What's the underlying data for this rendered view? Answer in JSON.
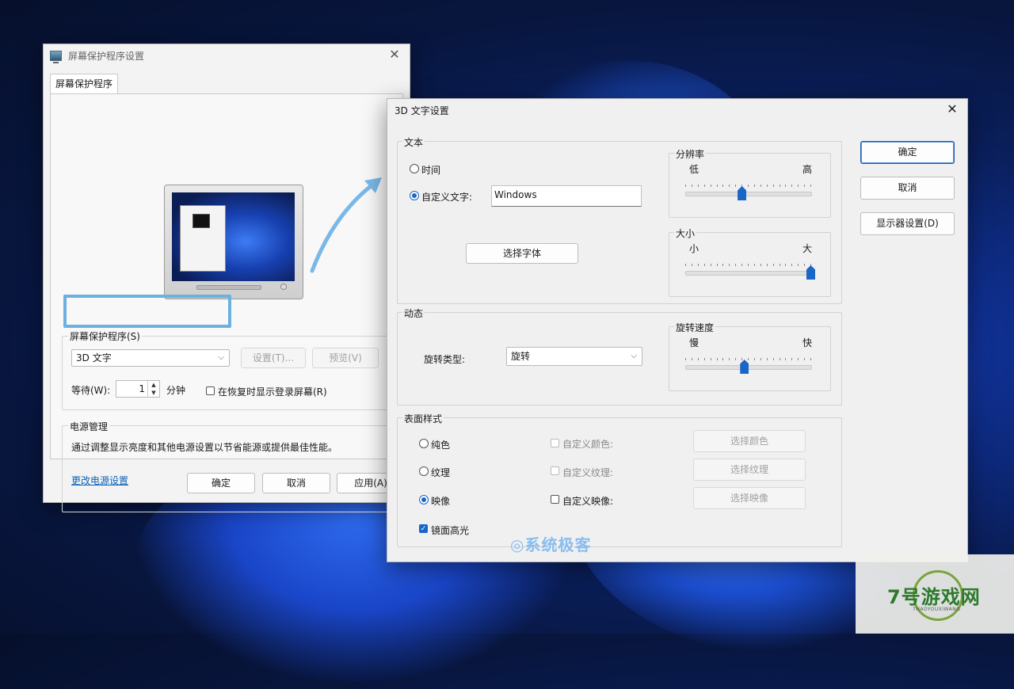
{
  "screensaver_window": {
    "title": "屏幕保护程序设置",
    "tab": "屏幕保护程序",
    "group_label": "屏幕保护程序(S)",
    "selected_screensaver": "3D 文字",
    "settings_button": "设置(T)...",
    "preview_button": "预览(V)",
    "wait_label": "等待(W):",
    "wait_value": "1",
    "minutes_label": "分钟",
    "resume_checkbox_label": "在恢复时显示登录屏幕(R)",
    "power_group_label": "电源管理",
    "power_description": "通过调整显示亮度和其他电源设置以节省能源或提供最佳性能。",
    "power_link": "更改电源设置",
    "ok_button": "确定",
    "cancel_button": "取消",
    "apply_button": "应用(A)"
  },
  "text3d_window": {
    "title": "3D 文字设置",
    "text_section": {
      "label": "文本",
      "radio_time": "时间",
      "radio_custom": "自定义文字:",
      "custom_text_value": "Windows",
      "choose_font_button": "选择字体",
      "resolution_label": "分辨率",
      "resolution_low": "低",
      "resolution_high": "高",
      "resolution_level": 0.45,
      "size_label": "大小",
      "size_small": "小",
      "size_large": "大",
      "size_level": 1.0
    },
    "motion_section": {
      "label": "动态",
      "rotation_type_label": "旋转类型:",
      "rotation_type_value": "旋转",
      "speed_label": "旋转速度",
      "speed_slow": "慢",
      "speed_fast": "快",
      "speed_level": 0.47
    },
    "surface_section": {
      "label": "表面样式",
      "solid_label": "纯色",
      "texture_label": "纹理",
      "reflection_label": "映像",
      "custom_color_label": "自定义颜色:",
      "custom_texture_label": "自定义纹理:",
      "custom_reflection_label": "自定义映像:",
      "choose_color_button": "选择颜色",
      "choose_texture_button": "选择纹理",
      "choose_reflection_button": "选择映像",
      "specular_label": "镜面高光"
    },
    "ok_button": "确定",
    "cancel_button": "取消",
    "display_settings_button": "显示器设置(D)"
  },
  "watermark": {
    "site_name": "系统极客",
    "logo_text": "7号游戏网",
    "logo_sub": "7HAOYOUXIWANG"
  },
  "colors": {
    "accent": "#1a66c7",
    "highlight_box": "#6cb0e0"
  }
}
